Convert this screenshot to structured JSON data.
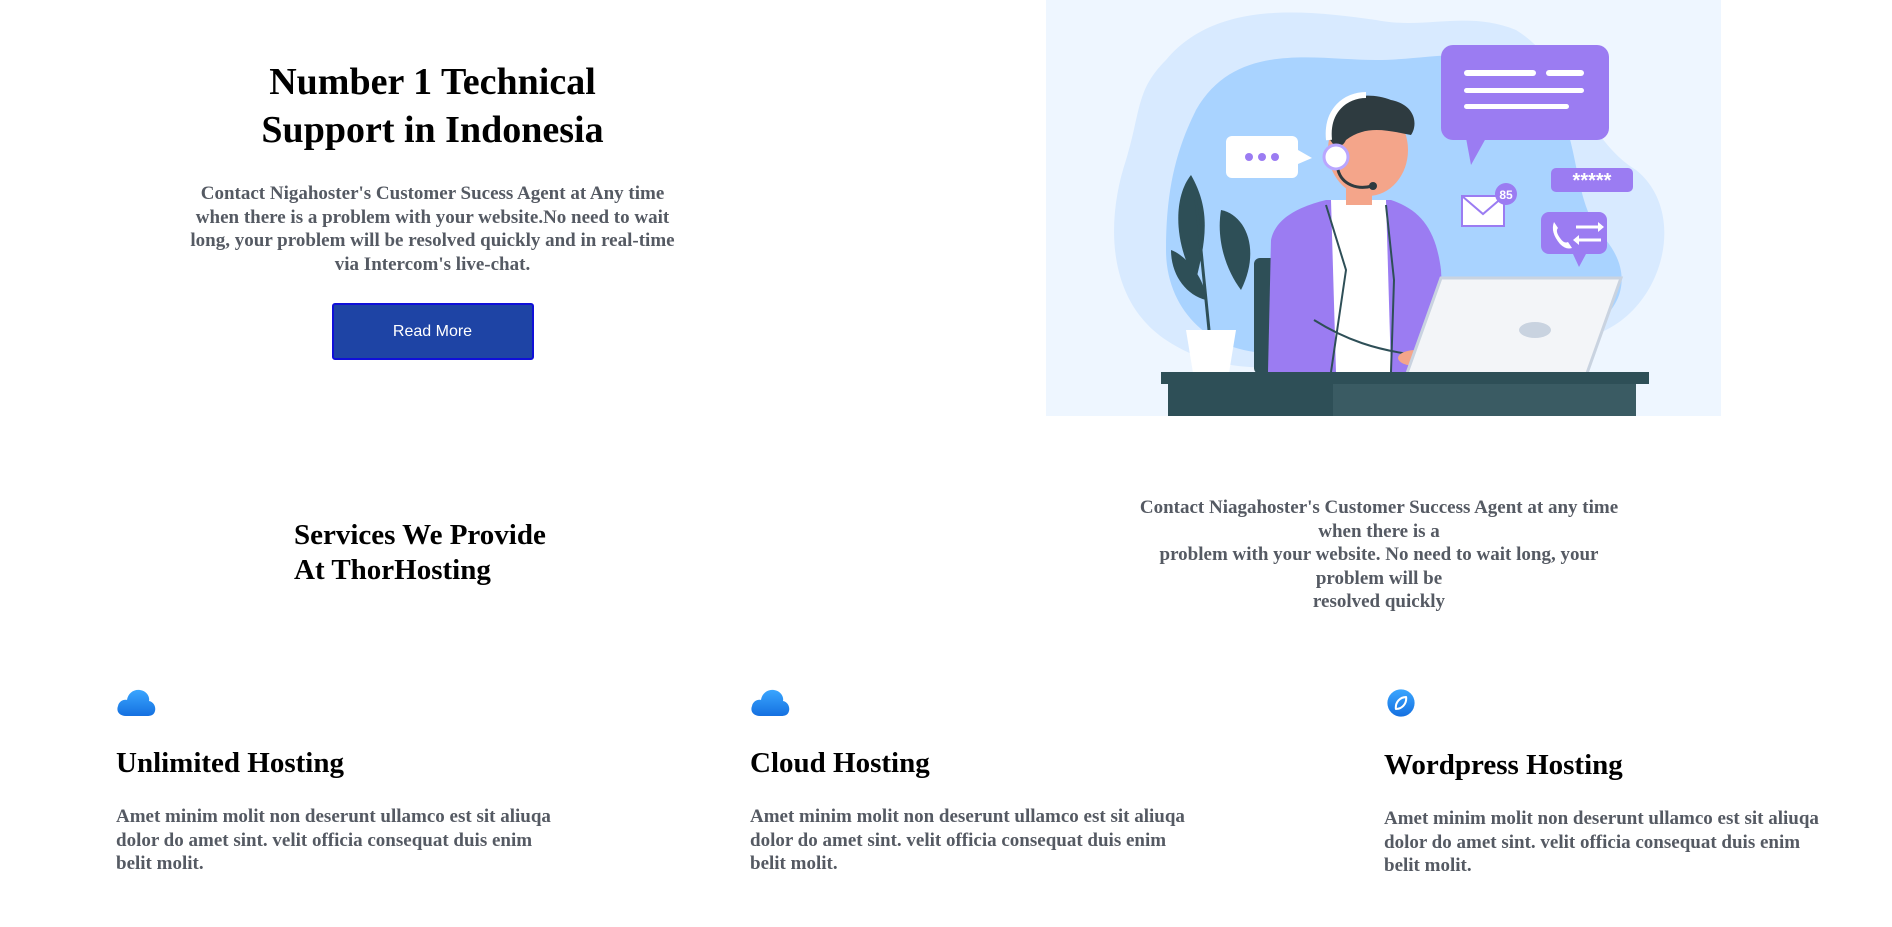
{
  "hero": {
    "title_line1": "Number 1 Technical",
    "title_line2": "Support in Indonesia",
    "description": "Contact Nigahoster's Customer Sucess Agent at Any time when there is a problem with your website.No need to wait long, your problem will be resolved quickly and in real-time via Intercom's live-chat.",
    "button_label": "Read More",
    "illustration": {
      "password_mask": "*****",
      "notification_count": "85",
      "chat_bubble_dots": "...",
      "colors": {
        "background": "#eef6ff",
        "blob": "#a9d3ff",
        "purple": "#9b7cf2",
        "desk": "#2e4f57"
      }
    }
  },
  "services": {
    "title_line1": "Services We Provide",
    "title_line2": "At ThorHosting",
    "description_lines": [
      "Contact Niagahoster's Customer Success Agent at any time when there is a",
      "problem with your website. No need to wait long, your problem will be",
      "resolved quickly"
    ],
    "cards": [
      {
        "icon": "cloud-icon",
        "title": "Unlimited Hosting",
        "description": "Amet minim molit non deserunt ullamco est sit aliuqa dolor do amet sint. velit officia consequat duis enim belit molit."
      },
      {
        "icon": "cloud-icon",
        "title": "Cloud Hosting",
        "description": "Amet minim molit non deserunt ullamco est sit aliuqa dolor do amet sint. velit officia consequat duis enim belit molit."
      },
      {
        "icon": "leaf-icon",
        "title": "Wordpress Hosting",
        "description": "Amet minim molit non deserunt ullamco est sit aliuqa dolor do amet sint. velit officia consequat duis enim belit molit."
      }
    ]
  },
  "colors": {
    "accent_button": "#1e44a5",
    "body_text": "#555a63",
    "icon_blue": "#1a8ff0"
  }
}
